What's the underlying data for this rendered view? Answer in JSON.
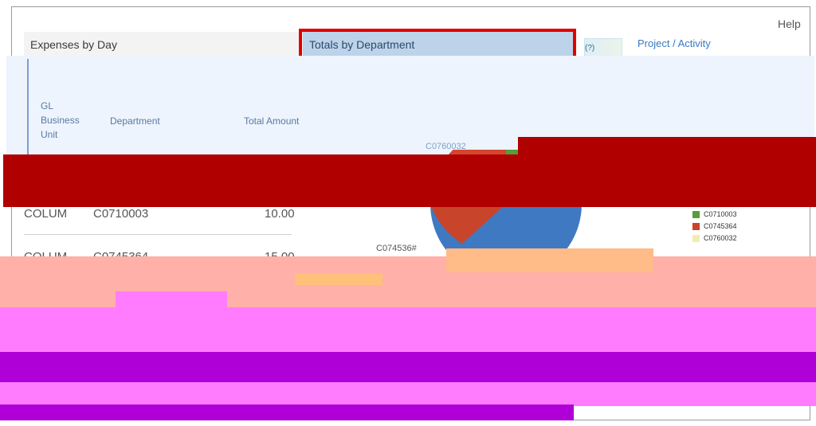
{
  "header": {
    "help_label": "Help"
  },
  "tabs": [
    {
      "label": "Expenses by Day"
    },
    {
      "label": "Totals by Department"
    },
    {
      "label": "Project / Activity"
    }
  ],
  "table": {
    "headers": {
      "gl_business_unit": "GL Business Unit",
      "department": "Department",
      "total_amount": "Total Amount"
    },
    "rows": [
      {
        "unit": "COLUM",
        "department": "C0710003",
        "amount": "10.00"
      },
      {
        "unit": "COLUM",
        "department": "C0745364",
        "amount": "15.00"
      }
    ]
  },
  "chart_data": {
    "type": "pie",
    "labels": [
      "C0710003",
      "C0745364",
      "C0760032"
    ],
    "colors": [
      "#5a9b3a",
      "#c8452b",
      "#f2ecb0"
    ],
    "values": [
      10,
      15,
      5
    ],
    "callouts": {
      "top": "C0760032",
      "left": "C074536#"
    }
  },
  "colors": {
    "selected_tab_bg": "#bcd3ea",
    "highlight_border": "#e00000",
    "link_color": "#3a79c2"
  }
}
